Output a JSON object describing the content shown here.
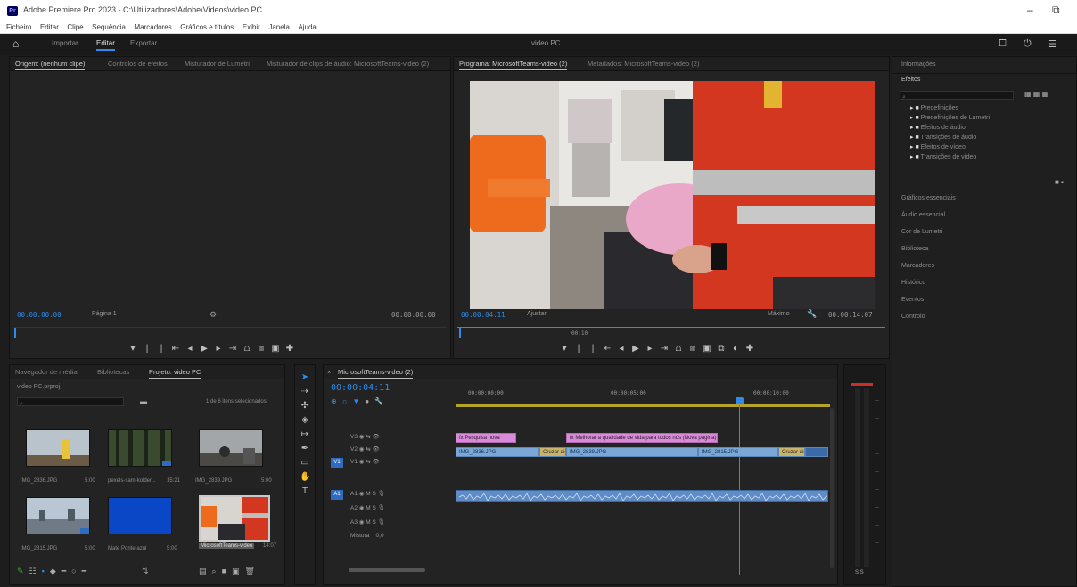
{
  "window": {
    "title": "Adobe Premiere Pro 2023 - C:\\Utilizadores\\Adobe\\Videos\\video PC",
    "controls": [
      "–",
      "⧉"
    ]
  },
  "menu": [
    "Ficheiro",
    "Editar",
    "Clipe",
    "Sequência",
    "Marcadores",
    "Gráficos e títulos",
    "Exibir",
    "Janela",
    "Ajuda"
  ],
  "workspace": {
    "tabs": [
      "Importar",
      "Editar",
      "Exportar"
    ],
    "active": "Editar",
    "project_name": "video PC"
  },
  "source_monitor": {
    "tabs": [
      "Origem: (nenhum clipe)",
      "Controlos de efeitos",
      "Misturador de Lumetri",
      "Misturador de clips de áudio: MicrosoftTeams-video (2)"
    ],
    "timecode_left": "00:00:00:00",
    "fit": "Página 1",
    "timecode_right": "00:00:00:00"
  },
  "program_monitor": {
    "tabs": [
      "Programa: MicrosoftTeams-video (2)",
      "Metadados: MicrosoftTeams-video (2)"
    ],
    "timecode_left": "00:00:04:11",
    "fit": "Ajustar",
    "quality": "Máximo",
    "timecode_right": "00:00:14:07",
    "playhead_label": "00:10"
  },
  "info_panel": {
    "header": "Informações",
    "section": "Efeitos",
    "tree": [
      "Predefinições",
      "Predefinições de Lumetri",
      "Efeitos de áudio",
      "Transições de áudio",
      "Efeitos de vídeo",
      "Transições de vídeo"
    ],
    "items": [
      "Gráficos essenciais",
      "Áudio essencial",
      "Cor de Lumetri",
      "Biblioteca",
      "Marcadores",
      "Histórico",
      "Eventos",
      "Controlo"
    ]
  },
  "media_panel": {
    "tabs": [
      "Navegador de média",
      "Bibliotecas",
      "Projeto: video PC"
    ],
    "project_file": "video PC.prproj",
    "search_placeholder": "",
    "items_info": "1 de 6 itens selecionados",
    "thumbs": [
      {
        "name": "IMG_2836.JPG",
        "dur": "5:00"
      },
      {
        "name": "pexels-sam-kolder...",
        "dur": "15:21"
      },
      {
        "name": "IMG_2839.JPG",
        "dur": "5:00"
      },
      {
        "name": "IMG_2815.JPG",
        "dur": "5:00"
      },
      {
        "name": "Mate Ponte azul",
        "dur": "5:00"
      },
      {
        "name": "MicrosoftTeams-video",
        "dur": "14:07"
      }
    ]
  },
  "timeline": {
    "tab": "MicrosoftTeams-video (2)",
    "timecode": "00:00:04:11",
    "ruler": [
      "00:00:00:00",
      "00:00:05:00",
      "00:00:10:00"
    ],
    "clips_v2": [
      "fx Pesquisa nova",
      "fx Melhorar a qualidade de vida para todos nós (Nova página)"
    ],
    "clips_v1": [
      "IMG_2836.JPG",
      "IMG_2839.JPG",
      "IMG_2815.JPG",
      "Cruzar dissolver",
      "Cruzar dissolver"
    ],
    "tracks": [
      "V3",
      "V2",
      "V1",
      "A1",
      "A2",
      "A3"
    ],
    "mix_label": "Mistura",
    "mix_value": "0,0"
  }
}
